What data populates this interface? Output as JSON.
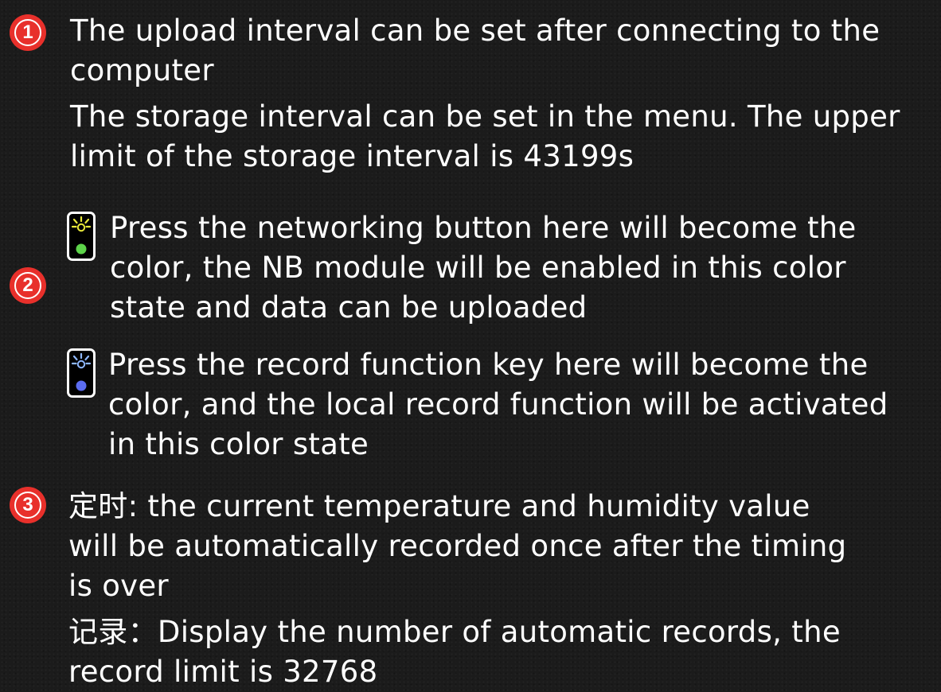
{
  "colors": {
    "background": "#1b1b1b",
    "text": "#ffffff",
    "marker": "#e8302b",
    "networking_led": "#5dd34a",
    "networking_rays": "#e8e83a",
    "record_led": "#5b6cf0",
    "record_rays": "#8fb8ff"
  },
  "section1": {
    "marker": "1",
    "lines": [
      "The upload interval can be set after connecting to the",
      "computer",
      "The storage interval can be set in the menu. The upper",
      "limit of the storage interval is 43199s"
    ]
  },
  "section2": {
    "marker": "2",
    "networking": {
      "icon": "green-led-indicator-icon",
      "lines": [
        "Press the networking button here will become the",
        "color, the NB module will be enabled in this color",
        "state and data can be uploaded"
      ]
    },
    "record": {
      "icon": "blue-led-indicator-icon",
      "lines": [
        "Press the record function key here will become the",
        "color, and the local record function will be activated",
        "in this color state"
      ]
    }
  },
  "section3": {
    "marker": "3",
    "lines": [
      "定时: the current temperature and humidity value",
      "will be automatically recorded once after the timing",
      "is over",
      "记录：Display the number of automatic records, the",
      "record limit is 32768"
    ]
  }
}
